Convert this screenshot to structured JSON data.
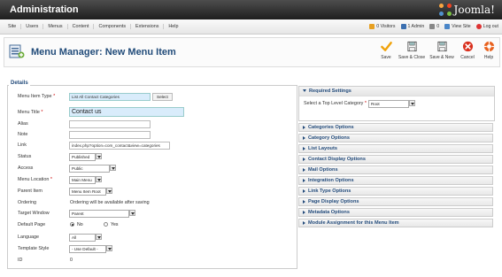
{
  "header": {
    "title": "Administration",
    "logo_text": "Joomla!"
  },
  "menubar": {
    "items": [
      "Site",
      "Users",
      "Menus",
      "Content",
      "Components",
      "Extensions",
      "Help"
    ],
    "status": {
      "visitors": "0 Visitors",
      "admin": "1 Admin",
      "messages": "0",
      "view_site": "View Site",
      "logout": "Log out"
    }
  },
  "toolbar": {
    "page_title": "Menu Manager: New Menu Item",
    "buttons": {
      "save": "Save",
      "save_close": "Save & Close",
      "save_new": "Save & New",
      "cancel": "Cancel",
      "help": "Help"
    }
  },
  "details": {
    "legend": "Details",
    "menu_item_type": {
      "label": "Menu Item Type",
      "value": "List All Contact Categories",
      "button": "Select"
    },
    "menu_title": {
      "label": "Menu Title",
      "value": "Contact us"
    },
    "alias": {
      "label": "Alias",
      "value": ""
    },
    "note": {
      "label": "Note",
      "value": ""
    },
    "link": {
      "label": "Link",
      "value": "index.php?option=com_contact&view=categories"
    },
    "status": {
      "label": "Status",
      "value": "Published"
    },
    "access": {
      "label": "Access",
      "value": "Public"
    },
    "menu_location": {
      "label": "Menu Location",
      "value": "Main Menu"
    },
    "parent_item": {
      "label": "Parent Item",
      "value": "Menu Item Root"
    },
    "ordering": {
      "label": "Ordering",
      "value": "Ordering will be available after saving"
    },
    "target_window": {
      "label": "Target Window",
      "value": "Parent"
    },
    "default_page": {
      "label": "Default Page",
      "no": "No",
      "yes": "Yes"
    },
    "language": {
      "label": "Language",
      "value": "All"
    },
    "template_style": {
      "label": "Template Style",
      "value": "- Use Default -"
    },
    "id": {
      "label": "ID",
      "value": "0"
    }
  },
  "required_settings": {
    "title": "Required Settings",
    "top_level_label": "Select a Top Level Category",
    "top_level_value": "Root"
  },
  "options": [
    "Categories Options",
    "Category Options",
    "List Layouts",
    "Contact Display Options",
    "Mail Options",
    "Integration Options",
    "Link Type Options",
    "Page Display Options",
    "Metadata Options",
    "Module Assignment for this Menu Item"
  ],
  "colors": {
    "title_blue": "#224c7a",
    "save_green": "#f0a20a",
    "cancel_red": "#d9301e",
    "help_orange": "#e8601c"
  }
}
